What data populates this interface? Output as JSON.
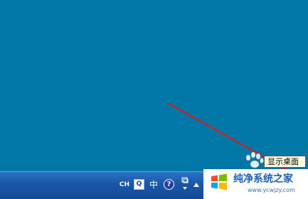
{
  "desktop": {
    "background_color": "#0077a7"
  },
  "tooltip": {
    "text": "显示桌面"
  },
  "taskbar": {
    "language_indicator": "CH",
    "ime_icon": "qq-input-icon",
    "ime_mode": "中",
    "help_icon_glyph": "?",
    "show_desktop_icon": "paw-icon"
  },
  "watermark": {
    "title": "纯净系统之家",
    "url": "www.ycwjzy.com"
  },
  "annotation": {
    "arrow_color": "#d11f1f"
  }
}
